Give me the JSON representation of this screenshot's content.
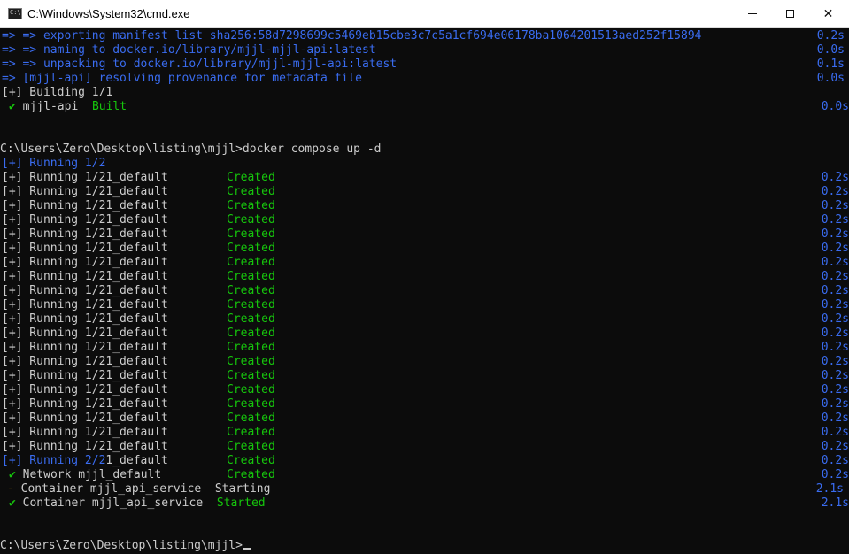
{
  "window": {
    "title": "C:\\Windows\\System32\\cmd.exe",
    "icon_text": "C:\\",
    "controls": {
      "minimize": "minimize",
      "maximize": "maximize",
      "close": "✕"
    }
  },
  "colors": {
    "background": "#0c0c0c",
    "text": "#cccccc",
    "blue": "#3a6cf0",
    "green": "#16c60c"
  },
  "terminal": {
    "build_lines": [
      {
        "text": "=> => exporting manifest list sha256:58d7298699c5469eb15cbe3c7c5a1cf694e06178ba1064201513aed252f15894",
        "time": "0.2s"
      },
      {
        "text": "=> => naming to docker.io/library/mjjl-mjjl-api:latest",
        "time": "0.0s"
      },
      {
        "text": "=> => unpacking to docker.io/library/mjjl-mjjl-api:latest",
        "time": "0.1s"
      },
      {
        "text": "=> [mjjl-api] resolving provenance for metadata file",
        "time": "0.0s"
      }
    ],
    "building_line": "[+] Building 1/1",
    "built_line": {
      "check": "✔",
      "name": "mjjl-api",
      "status": "Built",
      "time": "0.0s"
    },
    "prompt_compose": "C:\\Users\\Zero\\Desktop\\listing\\mjjl>docker compose up -d",
    "running_header": "[+] Running 1/2",
    "running_line": {
      "text": "[+] Running 1/21_default",
      "status": "Created",
      "time": "0.2s"
    },
    "running_2_line": {
      "prefix": "[+] Running 2/2",
      "suffix": "1_default",
      "status": "Created",
      "time": "0.2s"
    },
    "network_line": {
      "check": "✔",
      "text": "Network mjjl_default",
      "status": "Created",
      "time": "0.2s"
    },
    "starting_line": {
      "dash": "-",
      "text": "Container mjjl_api_service",
      "status": "Starting",
      "time": "2.1s"
    },
    "started_line": {
      "check": "✔",
      "text": "Container mjjl_api_service",
      "status": "Started",
      "time": "2.1s"
    },
    "final_prompt": "C:\\Users\\Zero\\Desktop\\listing\\mjjl>"
  }
}
